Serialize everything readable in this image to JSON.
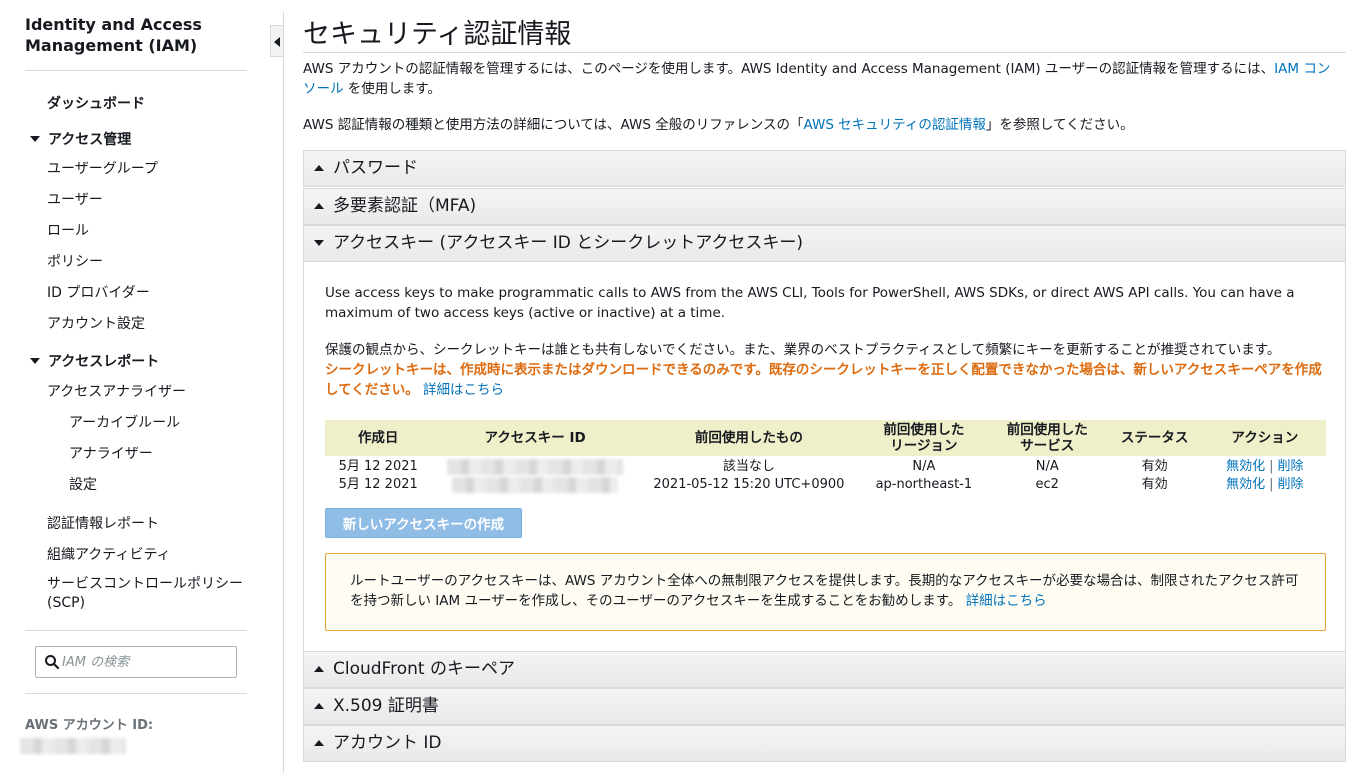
{
  "sidebar": {
    "title": "Identity and Access Management (IAM)",
    "dashboard": "ダッシュボード",
    "access_mgmt": {
      "label": "アクセス管理",
      "items": [
        "ユーザーグループ",
        "ユーザー",
        "ロール",
        "ポリシー",
        "ID プロバイダー",
        "アカウント設定"
      ]
    },
    "access_reports": {
      "label": "アクセスレポート",
      "analyzer": "アクセスアナライザー",
      "analyzer_items": [
        "アーカイブルール",
        "アナライザー",
        "設定"
      ],
      "items": [
        "認証情報レポート",
        "組織アクティビティ",
        "サービスコントロールポリシー (SCP)"
      ]
    },
    "search_placeholder": "IAM の検索",
    "account_id_label": "AWS アカウント ID:"
  },
  "main": {
    "title": "セキュリティ認証情報",
    "intro1_a": "AWS アカウントの認証情報を管理するには、このページを使用します。AWS Identity and Access Management (IAM) ユーザーの認証情報を管理するには、",
    "intro1_link": "IAM コンソール",
    "intro1_b": " を使用します。",
    "intro2_a": "AWS 認証情報の種類と使用方法の詳細については、AWS 全般のリファレンスの「",
    "intro2_link": "AWS セキュリティの認証情報",
    "intro2_b": "」を参照してください。",
    "sections": {
      "password": "パスワード",
      "mfa": "多要素認証（MFA)",
      "access_keys": "アクセスキー (アクセスキー ID とシークレットアクセスキー)",
      "cloudfront": "CloudFront のキーペア",
      "x509": "X.509 証明書",
      "account_id": "アカウント ID"
    },
    "access_keys": {
      "desc_en": "Use access keys to make programmatic calls to AWS from the AWS CLI, Tools for PowerShell, AWS SDKs, or direct AWS API calls. You can have a maximum of two access keys (active or inactive) at a time.",
      "desc_jp": "保護の観点から、シークレットキーは誰とも共有しないでください。また、業界のベストプラクティスとして頻繁にキーを更新することが推奨されています。",
      "warning": "シークレットキーは、作成時に表示またはダウンロードできるのみです。既存のシークレットキーを正しく配置できなかった場合は、新しいアクセスキーペアを作成してください。",
      "learn_more": "詳細はこちら",
      "columns": {
        "created": "作成日",
        "key_id": "アクセスキー ID",
        "last_used": "前回使用したもの",
        "region_1": "前回使用した",
        "region_2": "リージョン",
        "service_1": "前回使用した",
        "service_2": "サービス",
        "status": "ステータス",
        "actions": "アクション"
      },
      "rows": [
        {
          "created": "5月 12 2021",
          "last_used": "該当なし",
          "region": "N/A",
          "service": "N/A",
          "status": "有効",
          "deactivate": "無効化",
          "sep": "|",
          "delete": "削除"
        },
        {
          "created": "5月 12 2021",
          "last_used": "2021-05-12 15:20 UTC+0900",
          "region": "ap-northeast-1",
          "service": "ec2",
          "status": "有効",
          "deactivate": "無効化",
          "sep": "|",
          "delete": "削除"
        }
      ],
      "create_button": "新しいアクセスキーの作成",
      "root_notice": "ルートユーザーのアクセスキーは、AWS アカウント全体への無制限アクセスを提供します。長期的なアクセスキーが必要な場合は、制限されたアクセス許可を持つ新しい IAM ユーザーを作成し、そのユーザーのアクセスキーを生成することをお勧めします。",
      "root_learn_more": "詳細はこちら"
    }
  },
  "colors": {
    "link": "#0073bb",
    "warning": "#dd6b10",
    "table_header": "#efefc9",
    "button": "#8fbde6",
    "notice_border": "#e5a33a"
  },
  "icons": {
    "search": "search-icon",
    "collapse": "chevron-left-icon"
  }
}
